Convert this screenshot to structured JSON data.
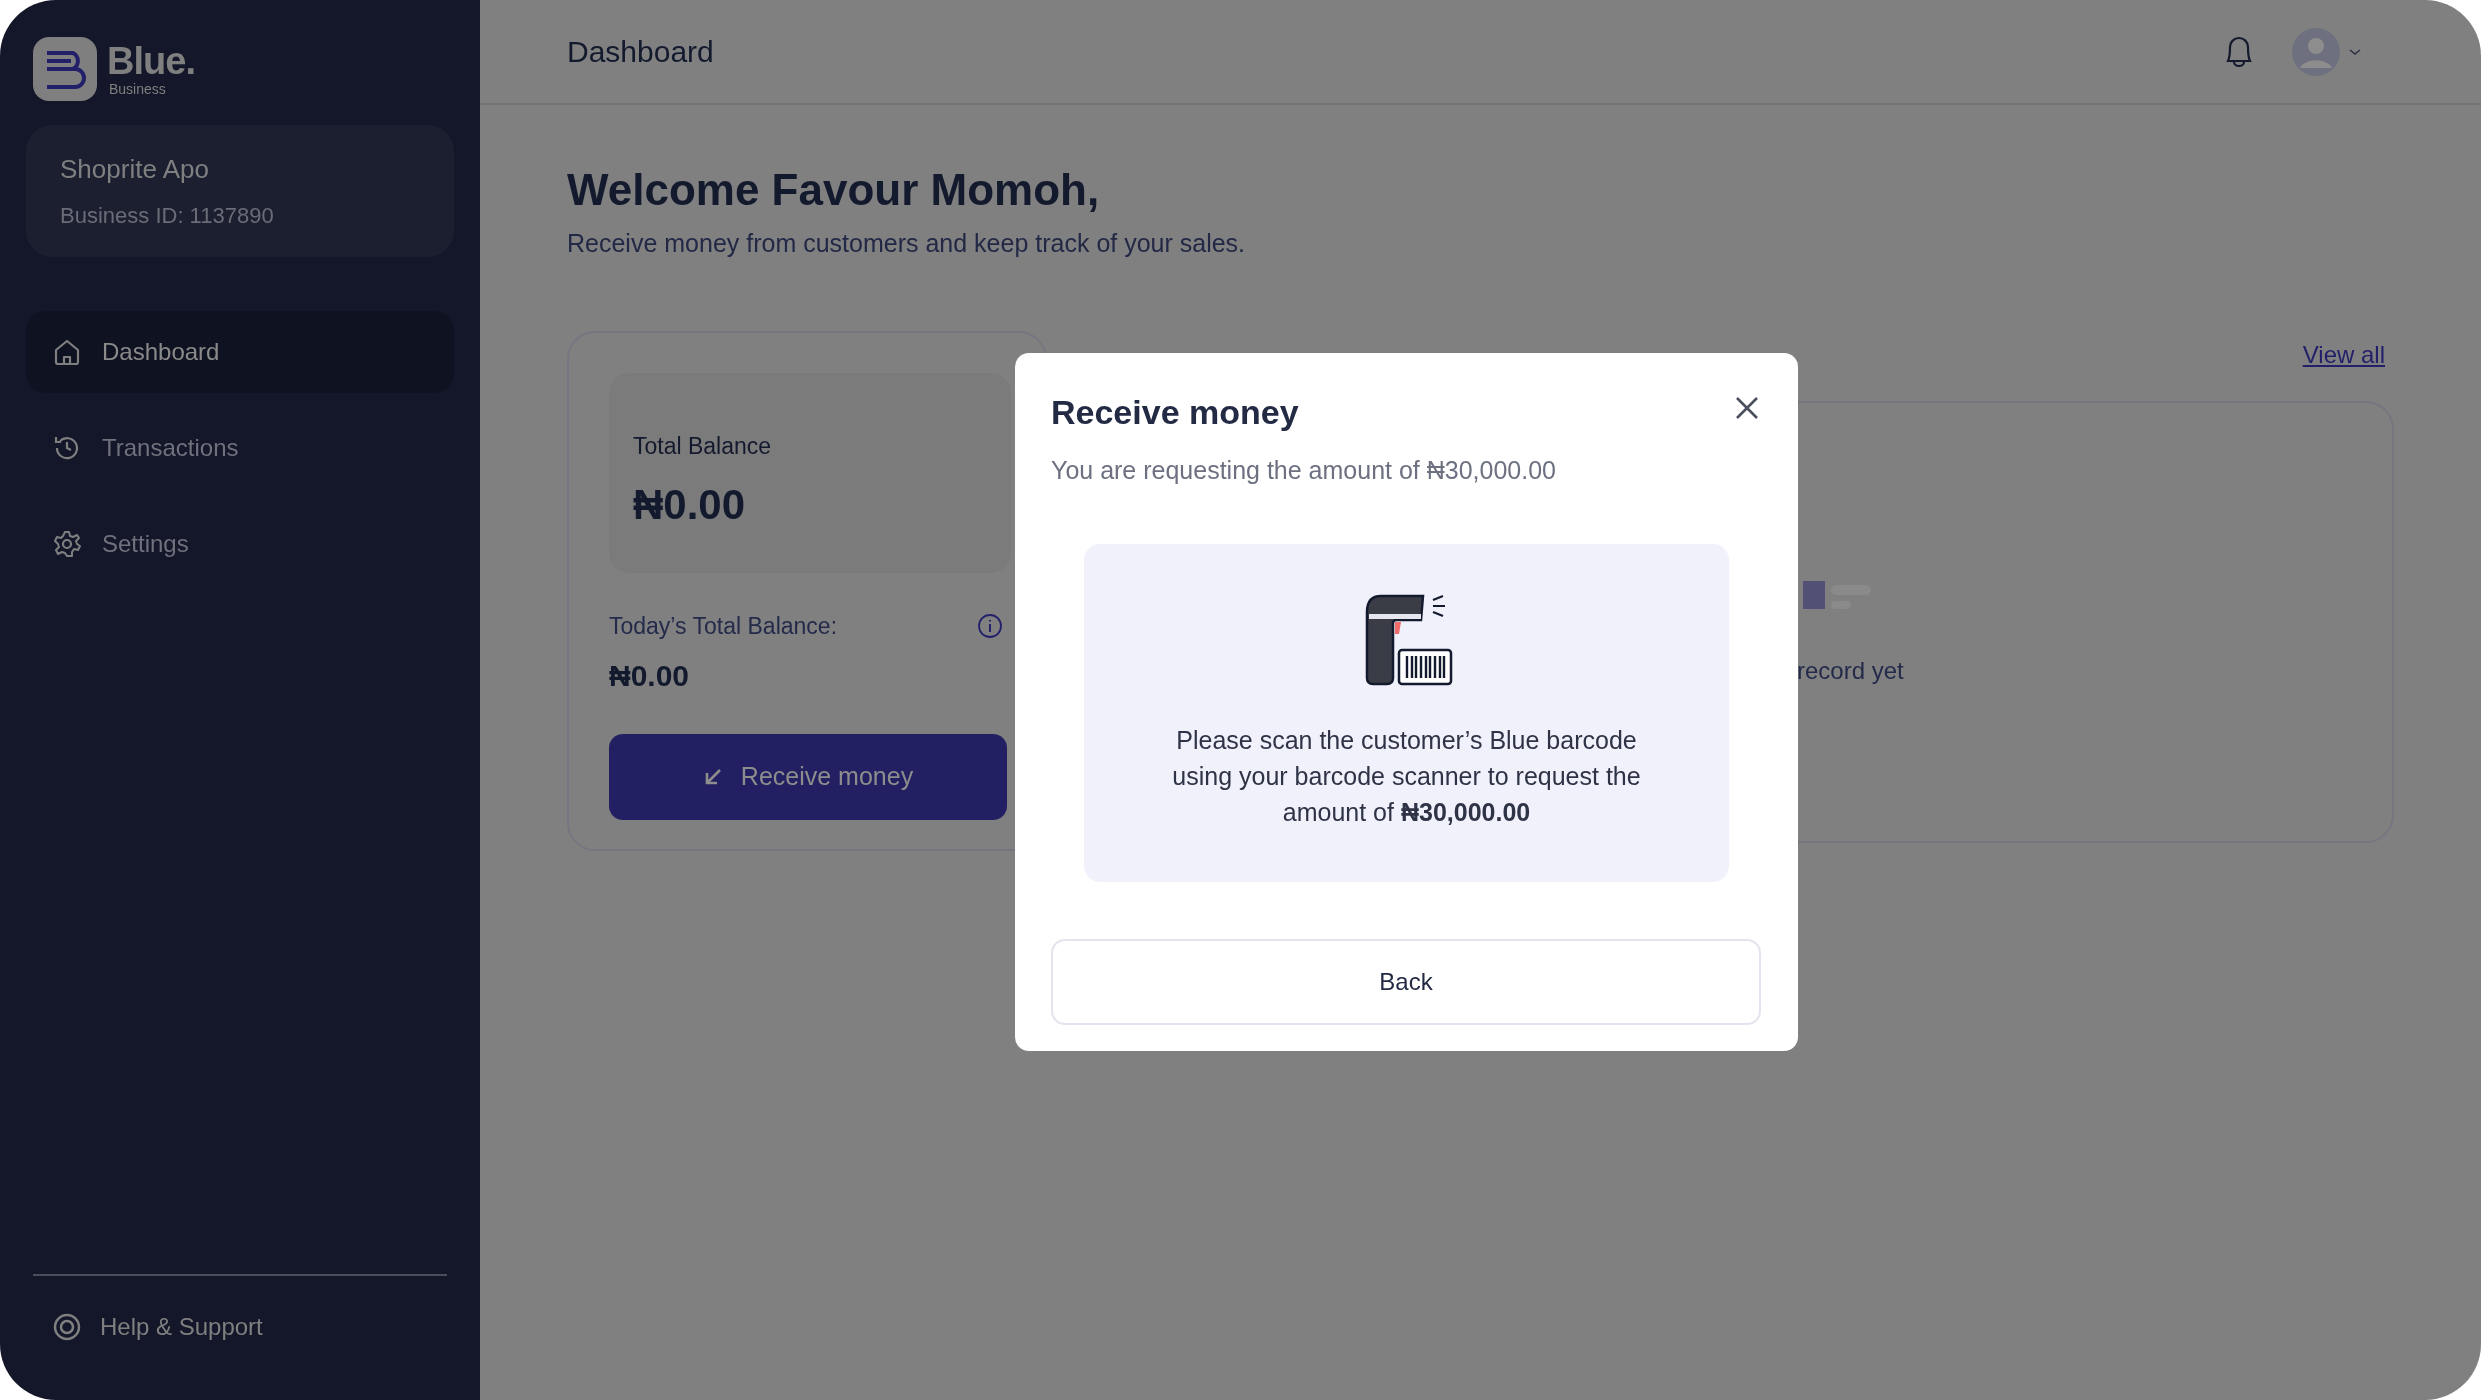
{
  "sidebar": {
    "logo": {
      "name": "Blue.",
      "tagline": "Business"
    },
    "business": {
      "name": "Shoprite Apo",
      "id_label": "Business ID: 1137890"
    },
    "nav": [
      {
        "label": "Dashboard",
        "selected": true
      },
      {
        "label": "Transactions",
        "selected": false
      },
      {
        "label": "Settings",
        "selected": false
      }
    ],
    "footer": {
      "label": "Help & Support"
    }
  },
  "header": {
    "title": "Dashboard"
  },
  "welcome": {
    "title": "Welcome Favour Momoh,",
    "subtitle": "Receive money from customers and keep track of your sales."
  },
  "balance_card": {
    "total_label": "Total Balance",
    "total_value": "₦0.00",
    "today_label": "Today’s Total Balance:",
    "today_value": "₦0.00",
    "button": "Receive money"
  },
  "recent": {
    "link": "View all",
    "empty_text": "record yet"
  },
  "modal": {
    "title": "Receive money",
    "subtitle": "You are requesting the amount of ₦30,000.00",
    "message": "Please scan the customer’s Blue barcode using your barcode scanner to request the amount of **₦30,000.00**",
    "button": "Back"
  }
}
